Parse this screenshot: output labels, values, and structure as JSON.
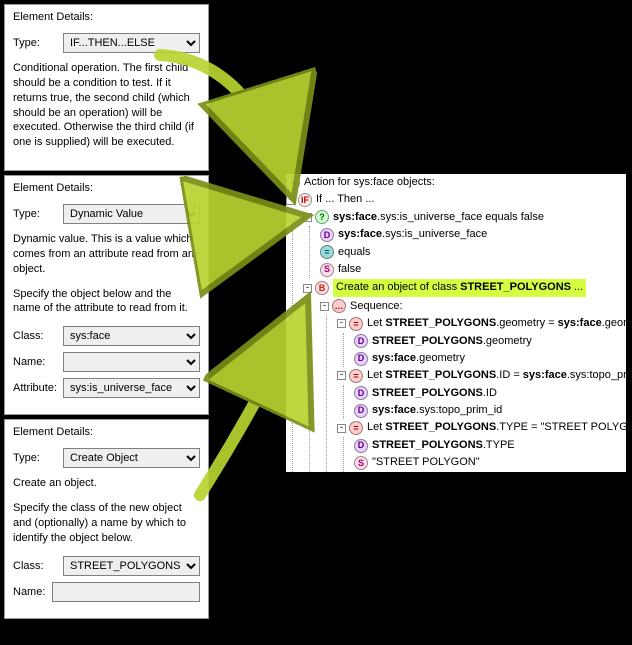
{
  "panels": {
    "p1": {
      "title": "Element Details:",
      "type_label": "Type:",
      "type_value": "IF...THEN...ELSE",
      "desc": "Conditional operation. The first child should be a condition to test. If it returns true, the second child (which should be an operation) will be executed. Otherwise the third child (if one is supplied) will be executed."
    },
    "p2": {
      "title": "Element Details:",
      "type_label": "Type:",
      "type_value": "Dynamic Value",
      "desc": "Dynamic value. This is a value which comes from an attribute read from an object.",
      "desc2": "Specify the object below and the name of the attribute to read from it.",
      "class_label": "Class:",
      "class_value": "sys:face",
      "name_label": "Name:",
      "name_value": "",
      "attr_label": "Attribute:",
      "attr_value": "sys:is_universe_face"
    },
    "p3": {
      "title": "Element Details:",
      "type_label": "Type:",
      "type_value": "Create Object",
      "desc": "Create an object.",
      "desc2": "Specify the class of the new object and (optionally) a name by which to identify the object below.",
      "class_label": "Class:",
      "class_value": "STREET_POLYGONS",
      "name_label": "Name:",
      "name_value": ""
    }
  },
  "tree": {
    "n0": "Action for sys:face objects:",
    "n1": "If ... Then ...",
    "n2a": "sys:face",
    "n2b": ".sys:is_universe_face equals false",
    "n3a": "sys:face",
    "n3b": ".sys:is_universe_face",
    "n4": "equals",
    "n5": "false",
    "n6a": "Create an object of class ",
    "n6b": "STREET_POLYGONS",
    "n6c": " ...",
    "n7": "Sequence:",
    "n8a": "Let ",
    "n8b": "STREET_POLYGONS",
    "n8c": ".geometry = ",
    "n8d": "sys:face",
    "n8e": ".geometry",
    "n9a": "STREET_POLYGONS",
    "n9b": ".geometry",
    "n10a": "sys:face",
    "n10b": ".geometry",
    "n11a": "Let ",
    "n11b": "STREET_POLYGONS",
    "n11c": ".ID = ",
    "n11d": "sys:face",
    "n11e": ".sys:topo_prim_id",
    "n12a": "STREET_POLYGONS",
    "n12b": ".ID",
    "n13a": "sys:face",
    "n13b": ".sys:topo_prim_id",
    "n14a": "Let ",
    "n14b": "STREET_POLYGONS",
    "n14c": ".TYPE = \"STREET POLYGON\"",
    "n15a": "STREET_POLYGONS",
    "n15b": ".TYPE",
    "n16": "\"STREET POLYGON\""
  },
  "icons": {
    "A": "A",
    "IF": "IF",
    "Q": "?",
    "D": "D",
    "eq": "=",
    "S": "S",
    "B": "B",
    "seq": "…",
    "let": "="
  }
}
